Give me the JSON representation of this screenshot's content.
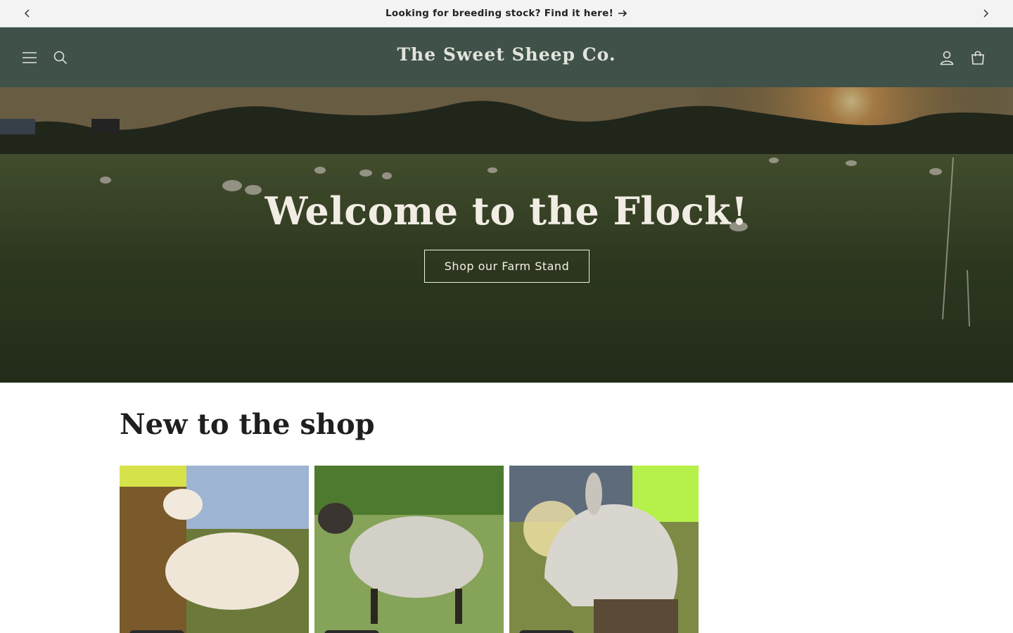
{
  "announcement": {
    "text": "Looking for breeding stock? Find it here!"
  },
  "header": {
    "logo": "The Sweet Sheep Co."
  },
  "hero": {
    "title": "Welcome to the Flock!",
    "button_label": "Shop our Farm Stand"
  },
  "section": {
    "title": "New to the shop"
  },
  "products": [
    {
      "image": "white-sheep-photo"
    },
    {
      "image": "gray-sheep-photo"
    },
    {
      "image": "sheep-portrait-photo"
    }
  ],
  "colors": {
    "header_bg": "#3f5148",
    "announcement_bg": "#f3f3f3",
    "logo_text": "#e2e4dc"
  }
}
